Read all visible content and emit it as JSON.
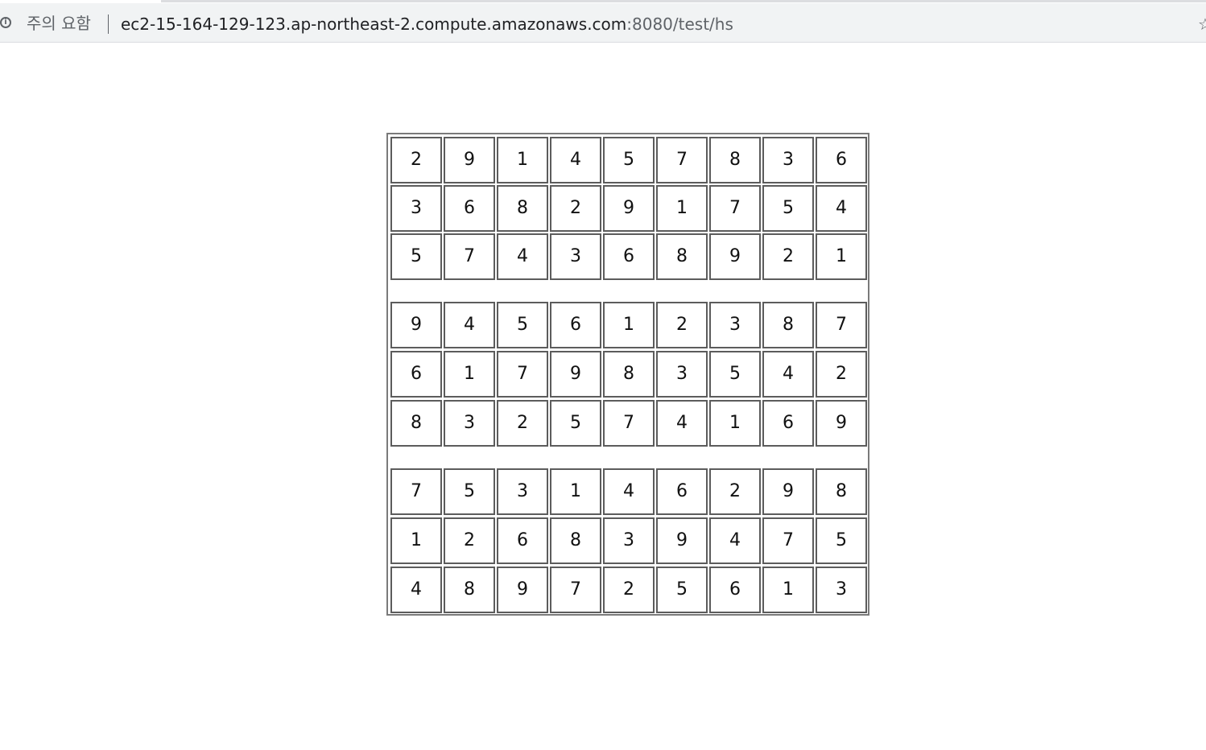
{
  "browser": {
    "security_label": "주의 요함",
    "url_host": "ec2-15-164-129-123.ap-northeast-2.compute.amazonaws.com",
    "url_path": ":8080/test/hs",
    "info_icon": "info-icon",
    "bookmark_icon": "star-icon"
  },
  "sudoku": {
    "rows": [
      [
        "2",
        "9",
        "1",
        "4",
        "5",
        "7",
        "8",
        "3",
        "6"
      ],
      [
        "3",
        "6",
        "8",
        "2",
        "9",
        "1",
        "7",
        "5",
        "4"
      ],
      [
        "5",
        "7",
        "4",
        "3",
        "6",
        "8",
        "9",
        "2",
        "1"
      ],
      [
        "9",
        "4",
        "5",
        "6",
        "1",
        "2",
        "3",
        "8",
        "7"
      ],
      [
        "6",
        "1",
        "7",
        "9",
        "8",
        "3",
        "5",
        "4",
        "2"
      ],
      [
        "8",
        "3",
        "2",
        "5",
        "7",
        "4",
        "1",
        "6",
        "9"
      ],
      [
        "7",
        "5",
        "3",
        "1",
        "4",
        "6",
        "2",
        "9",
        "8"
      ],
      [
        "1",
        "2",
        "6",
        "8",
        "3",
        "9",
        "4",
        "7",
        "5"
      ],
      [
        "4",
        "8",
        "9",
        "7",
        "2",
        "5",
        "6",
        "1",
        "3"
      ]
    ]
  }
}
